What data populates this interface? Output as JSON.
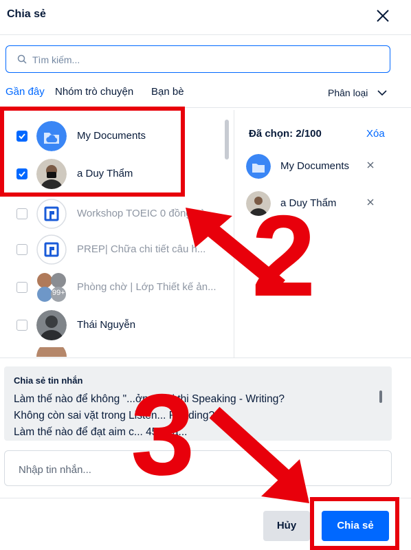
{
  "dialog": {
    "title": "Chia sẻ"
  },
  "search": {
    "placeholder": "Tìm kiếm..."
  },
  "tabs": [
    {
      "label": "Gần đây",
      "active": true
    },
    {
      "label": "Nhóm trò chuyện",
      "active": false
    },
    {
      "label": "Bạn bè",
      "active": false
    }
  ],
  "sort": {
    "label": "Phân loại"
  },
  "contacts": [
    {
      "name": "My Documents",
      "checked": true,
      "avatar": "cloud-folder-icon"
    },
    {
      "name": "a Duy Thẩm",
      "checked": true,
      "avatar": "person-photo"
    },
    {
      "name": "Workshop TOEIC 0 đồng cù...",
      "checked": false,
      "avatar": "prep-logo"
    },
    {
      "name": "PREP| Chữa chi tiết câu h...",
      "checked": false,
      "avatar": "prep-logo"
    },
    {
      "name": "Phòng chờ | Lớp Thiết kế ản...",
      "checked": false,
      "avatar": "group-avatar",
      "badge": "99+"
    },
    {
      "name": "Thái Nguyễn",
      "checked": false,
      "avatar": "person-photo"
    }
  ],
  "selected": {
    "header": "Đã chọn: 2/100",
    "clear_label": "Xóa",
    "items": [
      {
        "name": "My Documents"
      },
      {
        "name": "a Duy Thẩm"
      }
    ]
  },
  "share_message": {
    "title": "Chia sẻ tin nhắn",
    "text": "Làm thế nào để không \"...ởng\" khi thi Speaking - Writing?\nKhông còn sai vặt trong Listen... Reading?\nLàm thế nào để đạt aim c... 45 ngà..."
  },
  "message_input": {
    "placeholder": "Nhập tin nhắn..."
  },
  "buttons": {
    "cancel": "Hủy",
    "share": "Chia sẻ"
  },
  "annotations": {
    "step2": "2",
    "step3": "3"
  },
  "colors": {
    "accent": "#0068ff",
    "annotation_red": "#e8000b"
  }
}
